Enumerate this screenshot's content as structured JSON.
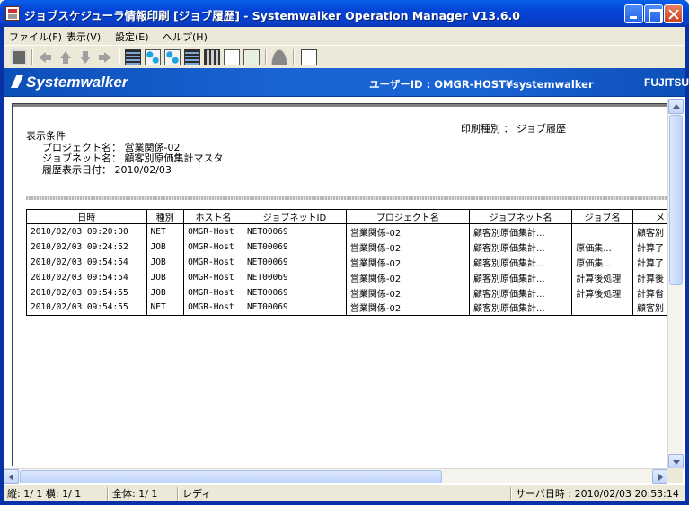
{
  "window": {
    "title": "ジョブスケジューラ情報印刷 [ジョブ履歴] - Systemwalker Operation Manager  V13.6.0"
  },
  "menu": [
    {
      "label": "ファイル(F)"
    },
    {
      "label": "表示(V)"
    },
    {
      "label": "設定(E)"
    },
    {
      "label": "ヘルプ(H)"
    }
  ],
  "toolbar": {
    "icons": [
      "printer-icon",
      "back-icon",
      "up-icon",
      "down-icon",
      "forward-icon",
      "job-list-icon",
      "jobnet-icon",
      "jobnet-tree-icon",
      "grid-icon",
      "doc-icon",
      "export-icon",
      "user-icon",
      "exit-icon"
    ]
  },
  "brand": {
    "logo_text": "Systemwalker",
    "user_id": "ユーザーID : OMGR-HOST¥systemwalker",
    "vendor": "FUJITSU"
  },
  "report": {
    "print_type": "印刷種別 ： ジョブ履歴",
    "conditions_label": "表示条件",
    "project_label": "プロジェクト名：",
    "project_value": "営業関係-02",
    "jobnet_label": "ジョブネット名：",
    "jobnet_value": "顧客別原価集計マスタ",
    "date_label": "履歴表示日付：",
    "date_value": "2010/02/03"
  },
  "table": {
    "headers": [
      "日時",
      "種別",
      "ホスト名",
      "ジョブネットID",
      "プロジェクト名",
      "ジョブネット名",
      "ジョブ名",
      "メ"
    ],
    "rows": [
      [
        "2010/02/03 09:20:00",
        "NET",
        "OMGR-Host",
        "NET00069",
        "営業関係-02",
        "顧客別原価集計...",
        "",
        "顧客別"
      ],
      [
        "2010/02/03 09:24:52",
        "JOB",
        "OMGR-Host",
        "NET00069",
        "営業関係-02",
        "顧客別原価集計...",
        "原価集...",
        "計算了"
      ],
      [
        "2010/02/03 09:54:54",
        "JOB",
        "OMGR-Host",
        "NET00069",
        "営業関係-02",
        "顧客別原価集計...",
        "原価集...",
        "計算了"
      ],
      [
        "2010/02/03 09:54:54",
        "JOB",
        "OMGR-Host",
        "NET00069",
        "営業関係-02",
        "顧客別原価集計...",
        "計算後処理",
        "計算後"
      ],
      [
        "2010/02/03 09:54:55",
        "JOB",
        "OMGR-Host",
        "NET00069",
        "営業関係-02",
        "顧客別原価集計...",
        "計算後処理",
        "計算省"
      ],
      [
        "2010/02/03 09:54:55",
        "NET",
        "OMGR-Host",
        "NET00069",
        "営業関係-02",
        "顧客別原価集計...",
        "",
        "顧客別"
      ]
    ]
  },
  "status": {
    "position": "縦: 1/ 1 横: 1/ 1",
    "total": "全体:  1/  1",
    "state": "レディ",
    "server_time": "サーバ日時 : 2010/02/03 20:53:14"
  }
}
